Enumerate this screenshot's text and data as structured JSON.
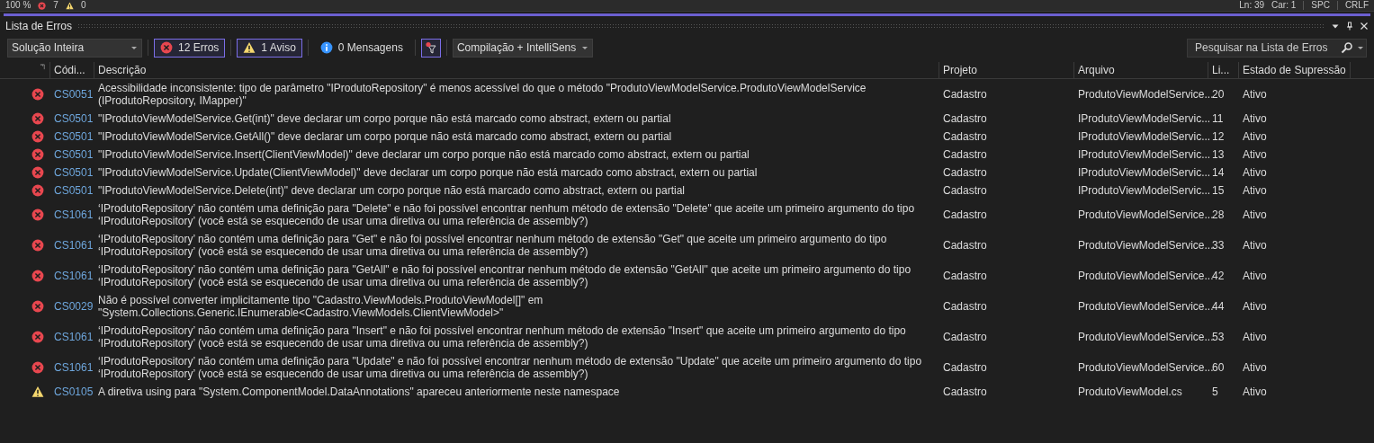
{
  "status_bar": {
    "zoom": "100 %",
    "error_count": "7",
    "warning_count": "0",
    "line": "Ln: 39",
    "column": "Car: 1",
    "spacing": "SPC",
    "line_ending": "CRLF"
  },
  "panel": {
    "title": "Lista de Erros"
  },
  "toolbar": {
    "scope": "Solução Inteira",
    "filters": [
      {
        "kind": "error",
        "label": "12 Erros",
        "selected": true
      },
      {
        "kind": "warning",
        "label": "1 Aviso",
        "selected": true
      },
      {
        "kind": "info",
        "label": "0 Mensagens",
        "selected": false
      }
    ],
    "filter_toggle": {
      "selected": true
    },
    "build_source": "Compilação + IntelliSens",
    "search": {
      "placeholder": "Pesquisar na Lista de Erros"
    }
  },
  "table": {
    "columns": [
      "Códi...",
      "Descrição",
      "Projeto",
      "Arquivo",
      "Li...",
      "Estado de Supressão"
    ],
    "rows": [
      {
        "kind": "error",
        "code": "CS0051",
        "description": "Acessibilidade inconsistente: tipo de parâmetro \"IProdutoRepository\" é menos acessível do que o método \"ProdutoViewModelService.ProdutoViewModelService (IProdutoRepository, IMapper)\"",
        "project": "Cadastro",
        "file": "ProdutoViewModelService...",
        "line": "20",
        "state": "Ativo"
      },
      {
        "kind": "error",
        "code": "CS0501",
        "description": "\"IProdutoViewModelService.Get(int)\" deve declarar um corpo porque não está marcado como abstract, extern ou partial",
        "project": "Cadastro",
        "file": "IProdutoViewModelServic...",
        "line": "11",
        "state": "Ativo"
      },
      {
        "kind": "error",
        "code": "CS0501",
        "description": "\"IProdutoViewModelService.GetAll()\" deve declarar um corpo porque não está marcado como abstract, extern ou partial",
        "project": "Cadastro",
        "file": "IProdutoViewModelServic...",
        "line": "12",
        "state": "Ativo"
      },
      {
        "kind": "error",
        "code": "CS0501",
        "description": "\"IProdutoViewModelService.Insert(ClientViewModel)\" deve declarar um corpo porque não está marcado como abstract, extern ou partial",
        "project": "Cadastro",
        "file": "IProdutoViewModelServic...",
        "line": "13",
        "state": "Ativo"
      },
      {
        "kind": "error",
        "code": "CS0501",
        "description": "\"IProdutoViewModelService.Update(ClientViewModel)\" deve declarar um corpo porque não está marcado como abstract, extern ou partial",
        "project": "Cadastro",
        "file": "IProdutoViewModelServic...",
        "line": "14",
        "state": "Ativo"
      },
      {
        "kind": "error",
        "code": "CS0501",
        "description": "\"IProdutoViewModelService.Delete(int)\" deve declarar um corpo porque não está marcado como abstract, extern ou partial",
        "project": "Cadastro",
        "file": "IProdutoViewModelServic...",
        "line": "15",
        "state": "Ativo"
      },
      {
        "kind": "error",
        "code": "CS1061",
        "description": "‘IProdutoRepository’ não contém uma definição para \"Delete\" e não foi possível encontrar nenhum método de extensão \"Delete\" que aceite um primeiro argumento do tipo ‘IProdutoRepository’ (você está se esquecendo de usar uma diretiva ou uma referência de assembly?)",
        "project": "Cadastro",
        "file": "ProdutoViewModelService...",
        "line": "28",
        "state": "Ativo"
      },
      {
        "kind": "error",
        "code": "CS1061",
        "description": "‘IProdutoRepository’ não contém uma definição para \"Get\" e não foi possível encontrar nenhum método de extensão \"Get\" que aceite um primeiro argumento do tipo ‘IProdutoRepository’ (você está se esquecendo de usar uma diretiva ou uma referência de assembly?)",
        "project": "Cadastro",
        "file": "ProdutoViewModelService...",
        "line": "33",
        "state": "Ativo"
      },
      {
        "kind": "error",
        "code": "CS1061",
        "description": "‘IProdutoRepository’ não contém uma definição para \"GetAll\" e não foi possível encontrar nenhum método de extensão \"GetAll\" que aceite um primeiro argumento do tipo ‘IProdutoRepository’ (você está se esquecendo de usar uma diretiva ou uma referência de assembly?)",
        "project": "Cadastro",
        "file": "ProdutoViewModelService...",
        "line": "42",
        "state": "Ativo"
      },
      {
        "kind": "error",
        "code": "CS0029",
        "description": "Não é possível converter implicitamente tipo \"Cadastro.ViewModels.ProdutoViewModel[]\" em \"System.Collections.Generic.IEnumerable<Cadastro.ViewModels.ClientViewModel>\"",
        "project": "Cadastro",
        "file": "ProdutoViewModelService...",
        "line": "44",
        "state": "Ativo"
      },
      {
        "kind": "error",
        "code": "CS1061",
        "description": "‘IProdutoRepository’ não contém uma definição para \"Insert\" e não foi possível encontrar nenhum método de extensão \"Insert\" que aceite um primeiro argumento do tipo ‘IProdutoRepository’ (você está se esquecendo de usar uma diretiva ou uma referência de assembly?)",
        "project": "Cadastro",
        "file": "ProdutoViewModelService...",
        "line": "53",
        "state": "Ativo"
      },
      {
        "kind": "error",
        "code": "CS1061",
        "description": "‘IProdutoRepository’ não contém uma definição para \"Update\" e não foi possível encontrar nenhum método de extensão \"Update\" que aceite um primeiro argumento do tipo ‘IProdutoRepository’ (você está se esquecendo de usar uma diretiva ou uma referência de assembly?)",
        "project": "Cadastro",
        "file": "ProdutoViewModelService...",
        "line": "60",
        "state": "Ativo"
      },
      {
        "kind": "warning",
        "code": "CS0105",
        "description": "A diretiva using para \"System.ComponentModel.DataAnnotations\" apareceu anteriormente neste namespace",
        "project": "Cadastro",
        "file": "ProdutoViewModel.cs",
        "line": "5",
        "state": "Ativo"
      }
    ]
  }
}
